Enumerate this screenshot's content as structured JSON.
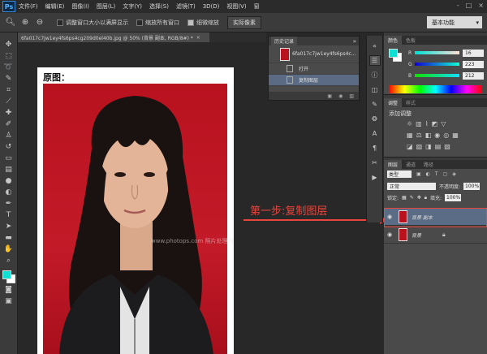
{
  "app": {
    "logo": "Ps",
    "menu": [
      "文件(F)",
      "编辑(E)",
      "图像(I)",
      "图层(L)",
      "文字(Y)",
      "选择(S)",
      "滤镜(T)",
      "3D(D)",
      "视图(V)",
      "窗"
    ],
    "window_controls": [
      "-",
      "□",
      "×"
    ]
  },
  "options_bar": {
    "check_resize": "调整窗口大小以满屏显示",
    "check_zoom_all": "缩放所有窗口",
    "check_scrubby": "细微缩放",
    "btn_actual": "实际像素",
    "workspace": "基本功能"
  },
  "document": {
    "tab_title": "6fa017c7jw1ey4fs6ps4cg209d0el40b.jpg @ 50% (背景 副本, RGB/8#) *",
    "tab_close": "×",
    "photo_title": "原图：",
    "watermark": "www.photops.com 照片处理网"
  },
  "annotation": {
    "text": "第一步:复制图层",
    "color": "#e8453c"
  },
  "history_panel": {
    "tab": "历史记录",
    "collapse": "»",
    "snapshot_name": "6fa017c7jw1ey4fs6ps4c...",
    "items": [
      "打开",
      "复制图层"
    ],
    "selected_index": 1
  },
  "color_panel": {
    "tabs": [
      "颜色",
      "色板"
    ],
    "fg_color": "#10dfd4",
    "bg_color": "#ffffff",
    "channels": [
      {
        "label": "R",
        "value": "16"
      },
      {
        "label": "G",
        "value": "223"
      },
      {
        "label": "B",
        "value": "212"
      }
    ]
  },
  "adjustments_panel": {
    "tabs": [
      "调整",
      "样式"
    ],
    "label": "添加调整"
  },
  "layers_panel": {
    "tabs": [
      "图层",
      "通道",
      "路径"
    ],
    "kind": "类型",
    "blend_mode": "正常",
    "opacity_label": "不透明度:",
    "opacity": "100%",
    "lock_label": "锁定:",
    "fill_label": "填充:",
    "fill": "100%",
    "layers": [
      {
        "name": "背景 副本",
        "selected": true
      },
      {
        "name": "背景",
        "selected": false
      }
    ]
  }
}
